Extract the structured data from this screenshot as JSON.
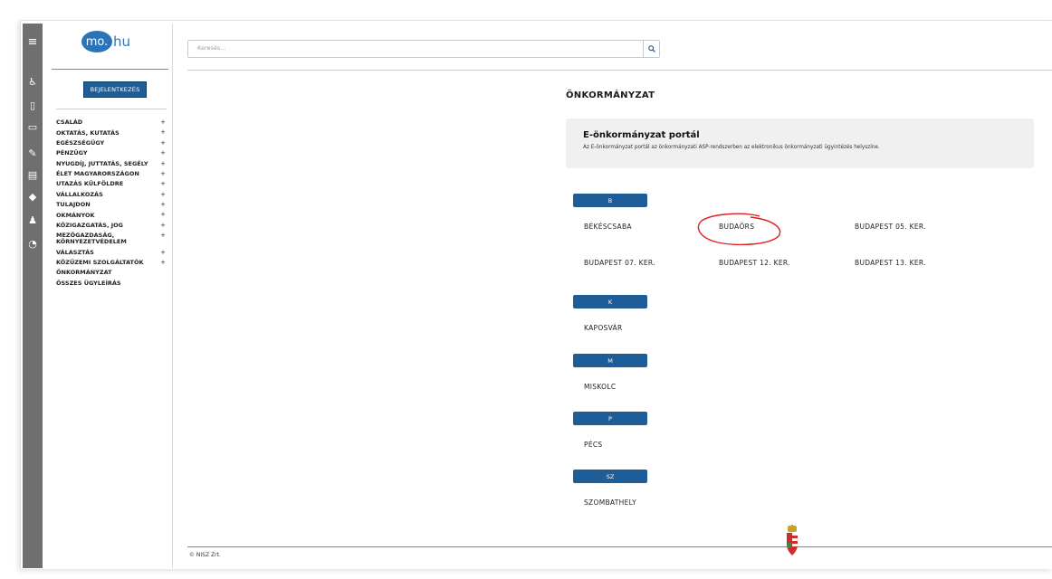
{
  "app": {
    "logo_mark": "mo.",
    "logo_suffix": "hu"
  },
  "login_label": "BEJELENTKEZÉS",
  "iconbar": [
    "menu-icon",
    "person-icon",
    "document-icon",
    "card-icon",
    "wrench-icon",
    "id-card-icon",
    "shield-icon",
    "users-icon",
    "info-icon"
  ],
  "menu": [
    {
      "label": "CSALÁD",
      "plus": "+"
    },
    {
      "label": "OKTATÁS, KUTATÁS",
      "plus": "+"
    },
    {
      "label": "EGÉSZSÉGÜGY",
      "plus": "+"
    },
    {
      "label": "PÉNZÜGY",
      "plus": "+"
    },
    {
      "label": "NYUGDÍJ, JUTTATÁS, SEGÉLY",
      "plus": "+"
    },
    {
      "label": "ÉLET MAGYARORSZÁGON",
      "plus": "+"
    },
    {
      "label": "UTAZÁS KÜLFÖLDRE",
      "plus": "+"
    },
    {
      "label": "VÁLLALKOZÁS",
      "plus": "+"
    },
    {
      "label": "TULAJDON",
      "plus": "+"
    },
    {
      "label": "OKMÁNYOK",
      "plus": "+"
    },
    {
      "label": "KÖZIGAZGATÁS, JOG",
      "plus": "+"
    },
    {
      "label": "MEZŐGAZDASÁG, KÖRNYEZETVÉDELEM",
      "plus": "+"
    },
    {
      "label": "VÁLASZTÁS",
      "plus": "+"
    },
    {
      "label": "KÖZÜZEMI SZOLGÁLTATÓK",
      "plus": "+"
    },
    {
      "label": "ÖNKORMÁNYZAT",
      "plus": ""
    },
    {
      "label": "ÖSSZES ÜGYLEÍRÁS",
      "plus": ""
    }
  ],
  "search": {
    "placeholder": "Keresés..."
  },
  "page_title": "ÖNKORMÁNYZAT",
  "portal": {
    "title": "E-önkormányzat portál",
    "desc": "Az E-önkormányzat portál az önkormányzati ASP-rendszerben az elektronikus önkormányzati ügyintézés helyszíne."
  },
  "groups": [
    {
      "letter": "B",
      "cities": [
        "BÉKÉSCSABA",
        "BUDAÖRS",
        "BUDAPEST 05. KER.",
        "BUDAPEST 07. KER.",
        "BUDAPEST 12. KER.",
        "BUDAPEST 13. KER."
      ]
    },
    {
      "letter": "K",
      "cities": [
        "KAPOSVÁR"
      ]
    },
    {
      "letter": "M",
      "cities": [
        "MISKOLC"
      ]
    },
    {
      "letter": "P",
      "cities": [
        "PÉCS"
      ]
    },
    {
      "letter": "SZ",
      "cities": [
        "SZOMBATHELY"
      ]
    }
  ],
  "footer": {
    "copyright": "© NISZ Zrt."
  },
  "colors": {
    "brand": "#1f5d99",
    "iconbar": "#6f6f6f",
    "highlight": "#e02020"
  }
}
